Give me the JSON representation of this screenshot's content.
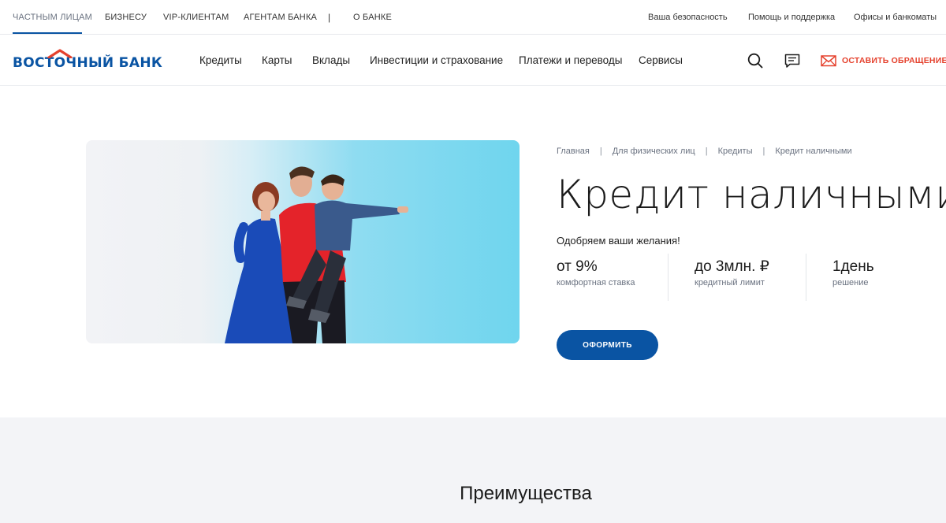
{
  "topbar": {
    "segments": [
      "ЧАСТНЫМ ЛИЦАМ",
      "БИЗНЕСУ",
      "VIP-КЛИЕНТАМ",
      "АГЕНТАМ БАНКА",
      "|",
      "О БАНКЕ"
    ],
    "active_segment": "ЧАСТНЫМ ЛИЦАМ",
    "links": [
      "Ваша безопасность",
      "Помощь и поддержка",
      "Офисы и банкоматы"
    ]
  },
  "nav": {
    "logo_text": "ВОСТОЧНЫЙ БАНК",
    "items": [
      "Кредиты",
      "Карты",
      "Вклады",
      "Инвестиции и страхование",
      "Платежи и переводы",
      "Сервисы"
    ],
    "icons": [
      "search-icon",
      "chat-icon",
      "envelope-icon"
    ],
    "appeal_label": "ОСТАВИТЬ ОБРАЩЕНИЕ"
  },
  "breadcrumb": [
    "Главная",
    "Для физических лиц",
    "Кредиты",
    "Кредит наличными"
  ],
  "hero": {
    "title": "Кредит наличными",
    "subtitle": "Одобряем ваши желания!",
    "facts": [
      {
        "value": "от 9%",
        "caption": "комфортная ставка"
      },
      {
        "value": "до 3млн. ₽",
        "caption": "кредитный лимит"
      },
      {
        "value": "1день",
        "caption": "решение"
      }
    ],
    "cta_label": "ОФОРМИТЬ",
    "image_subject": "family-photo"
  },
  "advantages": {
    "heading": "Преимущества"
  },
  "colors": {
    "brand_blue": "#0a54a3",
    "accent_red": "#e5412d",
    "band_bg": "#f3f4f7",
    "photo_sky": "#6fd5ee"
  }
}
